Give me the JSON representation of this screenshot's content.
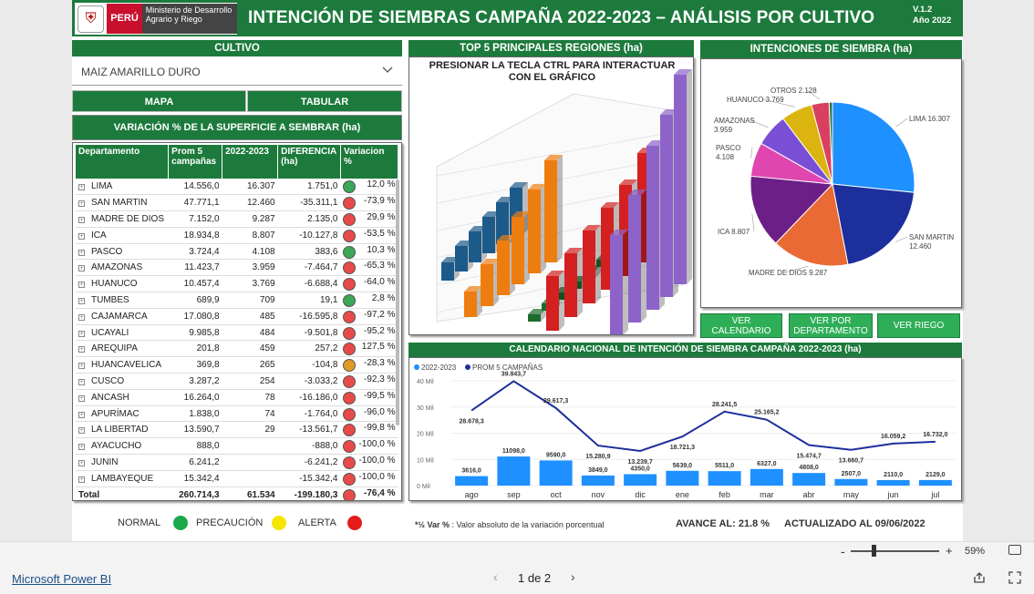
{
  "header": {
    "title": "INTENCIÓN DE SIEMBRAS CAMPAÑA 2022-2023 – ANÁLISIS POR CULTIVO",
    "version": "V.1.2",
    "year": "Año 2022",
    "logo_country": "PERÚ",
    "logo_ministry": "Ministerio de Desarrollo Agrario y Riego"
  },
  "cultivo": {
    "title": "CULTIVO",
    "selected": "MAIZ AMARILLO DURO"
  },
  "tabs": {
    "mapa": "MAPA",
    "tabular": "TABULAR"
  },
  "variation": {
    "title": "VARIACIÓN % DE LA SUPERFICIE A SEMBRAR  (ha)",
    "headers": [
      "Departamento",
      "Prom 5 campañas",
      "2022-2023",
      "DIFERENCIA (ha)",
      "Variacion %"
    ],
    "rows": [
      [
        "LIMA",
        "14.556,0",
        "16.307",
        "1.751,0",
        "12,0 %",
        "#3aa857"
      ],
      [
        "SAN MARTIN",
        "47.771,1",
        "12.460",
        "-35.311,1",
        "-73,9 %",
        "#e84a4a"
      ],
      [
        "MADRE DE DIOS",
        "7.152,0",
        "9.287",
        "2.135,0",
        "29,9 %",
        "#e84a4a"
      ],
      [
        "ICA",
        "18.934,8",
        "8.807",
        "-10.127,8",
        "-53,5 %",
        "#e84a4a"
      ],
      [
        "PASCO",
        "3.724,4",
        "4.108",
        "383,6",
        "10,3 %",
        "#3aa857"
      ],
      [
        "AMAZONAS",
        "11.423,7",
        "3.959",
        "-7.464,7",
        "-65,3 %",
        "#e84a4a"
      ],
      [
        "HUANUCO",
        "10.457,4",
        "3.769",
        "-6.688,4",
        "-64,0 %",
        "#e84a4a"
      ],
      [
        "TUMBES",
        "689,9",
        "709",
        "19,1",
        "2,8 %",
        "#3aa857"
      ],
      [
        "CAJAMARCA",
        "17.080,8",
        "485",
        "-16.595,8",
        "-97,2 %",
        "#e84a4a"
      ],
      [
        "UCAYALI",
        "9.985,8",
        "484",
        "-9.501,8",
        "-95,2 %",
        "#e84a4a"
      ],
      [
        "AREQUIPA",
        "201,8",
        "459",
        "257,2",
        "127,5 %",
        "#e84a4a"
      ],
      [
        "HUANCAVELICA",
        "369,8",
        "265",
        "-104,8",
        "-28,3 %",
        "#e09a2a"
      ],
      [
        "CUSCO",
        "3.287,2",
        "254",
        "-3.033,2",
        "-92,3 %",
        "#e84a4a"
      ],
      [
        "ANCASH",
        "16.264,0",
        "78",
        "-16.186,0",
        "-99,5 %",
        "#e84a4a"
      ],
      [
        "APURÍMAC",
        "1.838,0",
        "74",
        "-1.764,0",
        "-96,0 %",
        "#e84a4a"
      ],
      [
        "LA LIBERTAD",
        "13.590,7",
        "29",
        "-13.561,7",
        "-99,8 %",
        "#e84a4a"
      ],
      [
        "AYACUCHO",
        "888,0",
        "",
        "-888,0",
        "-100,0 %",
        "#e84a4a"
      ],
      [
        "JUNIN",
        "6.241,2",
        "",
        "-6.241,2",
        "-100,0 %",
        "#e84a4a"
      ],
      [
        "LAMBAYEQUE",
        "15.342,4",
        "",
        "-15.342,4",
        "-100,0 %",
        "#e84a4a"
      ]
    ],
    "total": [
      "Total",
      "260.714,3",
      "61.534",
      "-199.180,3",
      "-76,4 %",
      "#e84a4a"
    ]
  },
  "top5": {
    "title": "TOP 5 PRINCIPALES REGIONES (ha)",
    "hint": "PRESIONAR LA TECLA CTRL PARA INTERACTUAR CON EL GRÁFICO"
  },
  "pie": {
    "title": "INTENCIONES DE SIEMBRA (ha)",
    "chart_data": {
      "type": "pie",
      "slices": [
        {
          "label": "LIMA",
          "value": 16307,
          "text": "LIMA 16.307",
          "color": "#1e90ff"
        },
        {
          "label": "SAN MARTIN",
          "value": 12460,
          "text": "SAN MARTIN 12.460",
          "color": "#1c2f9c"
        },
        {
          "label": "MADRE DE DIOS",
          "value": 9287,
          "text": "MADRE DE DIOS 9.287",
          "color": "#ea6a35"
        },
        {
          "label": "ICA",
          "value": 8807,
          "text": "ICA 8.807",
          "color": "#6c1f87"
        },
        {
          "label": "PASCO",
          "value": 4108,
          "text": "PASCO 4.108",
          "color": "#e046b0"
        },
        {
          "label": "AMAZONAS",
          "value": 3959,
          "text": "AMAZONAS 3.959",
          "color": "#7a4fd6"
        },
        {
          "label": "HUANUCO",
          "value": 3769,
          "text": "HUANUCO 3.769",
          "color": "#dcb40f"
        },
        {
          "label": "OTROS",
          "value": 2128,
          "text": "OTROS 2.128",
          "color": "#d94060"
        },
        {
          "label": "",
          "value": 400,
          "text": "",
          "color": "#1c7a3c"
        }
      ]
    }
  },
  "buttons": {
    "calendario": "VER CALENDARIO",
    "departamento": "VER POR DEPARTAMENTO",
    "riego": "VER RIEGO"
  },
  "calendar": {
    "title": "CALENDARIO NACIONAL DE INTENCIÓN DE SIEMBRA CAMPAÑA 2022-2023 (ha)",
    "chart_data": {
      "type": "bar",
      "categories": [
        "ago",
        "sep",
        "oct",
        "nov",
        "dic",
        "ene",
        "feb",
        "mar",
        "abr",
        "may",
        "jun",
        "jul"
      ],
      "series": [
        {
          "name": "2022-2023",
          "type": "bar",
          "values": [
            3616,
            11098,
            9590,
            3849,
            4350,
            5639,
            5511,
            6327,
            4808,
            2507,
            2110,
            2129
          ],
          "labels": [
            "3616,0",
            "11098,0",
            "9590,0",
            "3849,0",
            "4350,0",
            "5639,0",
            "5511,0",
            "6327,0",
            "4808,0",
            "2507,0",
            "2110,0",
            "2129,0"
          ],
          "color": "#1e90ff"
        },
        {
          "name": "PROM 5 CAMPAÑAS",
          "type": "line",
          "values": [
            28678.3,
            39843.7,
            29617.3,
            15280.9,
            13239.7,
            18721.3,
            28241.5,
            25165.2,
            15474.7,
            13660.7,
            16059.2,
            16732.0
          ],
          "labels": [
            "28.678,3",
            "39.843,7",
            "29.617,3",
            "15.280,9",
            "13.239,7",
            "18.721,3",
            "28.241,5",
            "25.165,2",
            "15.474,7",
            "13.660,7",
            "16.059,2",
            "16.732,0"
          ],
          "color": "#1c2f9c"
        }
      ],
      "yticks": [
        "0 Mil",
        "10 Mil",
        "20 Mil",
        "30 Mil",
        "40 Mil"
      ],
      "ylim": [
        0,
        40000
      ],
      "legend_position": "top-left"
    }
  },
  "footer": {
    "normal": "NORMAL",
    "precaucion": "PRECAUCIÓN",
    "alerta": "ALERTA",
    "note_prefix": "*½ Var % ",
    "note": ": Valor absoluto de la variación porcentual",
    "avance": "AVANCE AL: 21.8 %",
    "actualizado": "ACTUALIZADO AL 09/06/2022"
  },
  "status": {
    "normal": "#1aa84a",
    "precaucion": "#f5e600",
    "alerta": "#e31b1b"
  },
  "viewer": {
    "zoom": "59%",
    "page": "1 de 2",
    "brand": "Microsoft Power BI"
  }
}
